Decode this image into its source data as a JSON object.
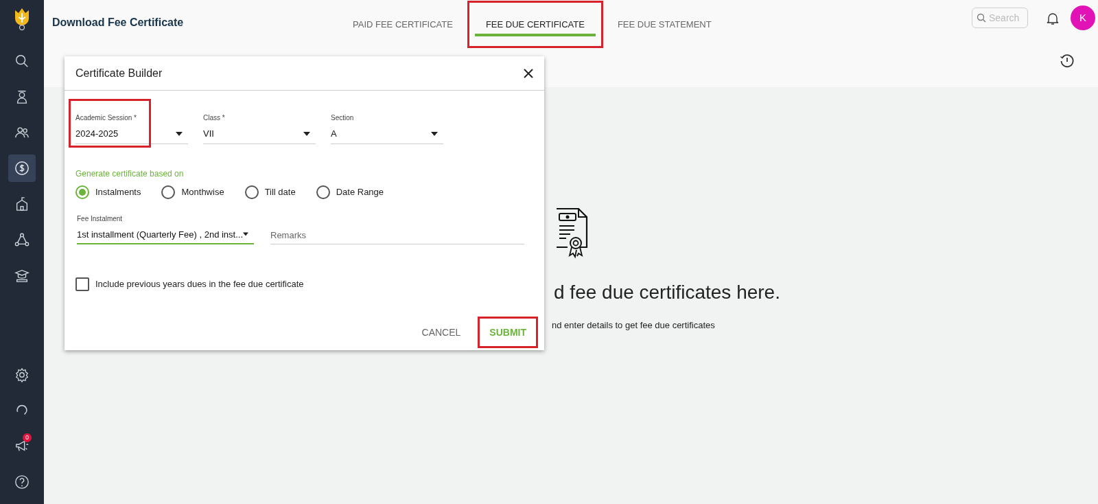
{
  "sidebar": {
    "items": [
      {
        "kind": "search",
        "selected": false
      },
      {
        "kind": "student",
        "selected": false
      },
      {
        "kind": "people",
        "selected": false
      },
      {
        "kind": "fees",
        "selected": true
      },
      {
        "kind": "school",
        "selected": false
      },
      {
        "kind": "network",
        "selected": false
      },
      {
        "kind": "academics",
        "selected": false
      }
    ],
    "bottom_items": [
      {
        "kind": "settings"
      },
      {
        "kind": "support"
      },
      {
        "kind": "announcements",
        "badge": "0"
      },
      {
        "kind": "help"
      }
    ]
  },
  "header": {
    "title": "Download Fee Certificate",
    "tabs": [
      {
        "label": "PAID FEE CERTIFICATE",
        "selected": false,
        "highlighted": false
      },
      {
        "label": "FEE DUE CERTIFICATE",
        "selected": true,
        "highlighted": true
      },
      {
        "label": "FEE DUE STATEMENT",
        "selected": false,
        "highlighted": false
      }
    ],
    "search": {
      "placeholder": "Search"
    },
    "avatar": "K"
  },
  "empty_state": {
    "heading": "d fee due certificates here.",
    "subtext": "nd enter details to get fee due certificates"
  },
  "dialog": {
    "title": "Certificate Builder",
    "selects": [
      {
        "label": "Academic Session *",
        "value": "2024-2025",
        "highlighted": true
      },
      {
        "label": "Class *",
        "value": "VII",
        "highlighted": false
      },
      {
        "label": "Section",
        "value": "A",
        "highlighted": false
      }
    ],
    "basis_label": "Generate certificate based on",
    "options": [
      {
        "label": "Instalments",
        "selected": true
      },
      {
        "label": "Monthwise",
        "selected": false
      },
      {
        "label": "Till date",
        "selected": false
      },
      {
        "label": "Date Range",
        "selected": false
      }
    ],
    "fee_instalment": {
      "label": "Fee Instalment",
      "value": "1st installment (Quarterly Fee) , 2nd inst..."
    },
    "remarks": {
      "placeholder": "Remarks"
    },
    "include_previous": {
      "label": "Include previous years dues in the fee due certificate",
      "checked": false
    },
    "buttons": [
      {
        "label": "CANCEL",
        "kind": "cancel",
        "highlighted": false
      },
      {
        "label": "SUBMIT",
        "kind": "submit",
        "highlighted": true
      }
    ]
  }
}
